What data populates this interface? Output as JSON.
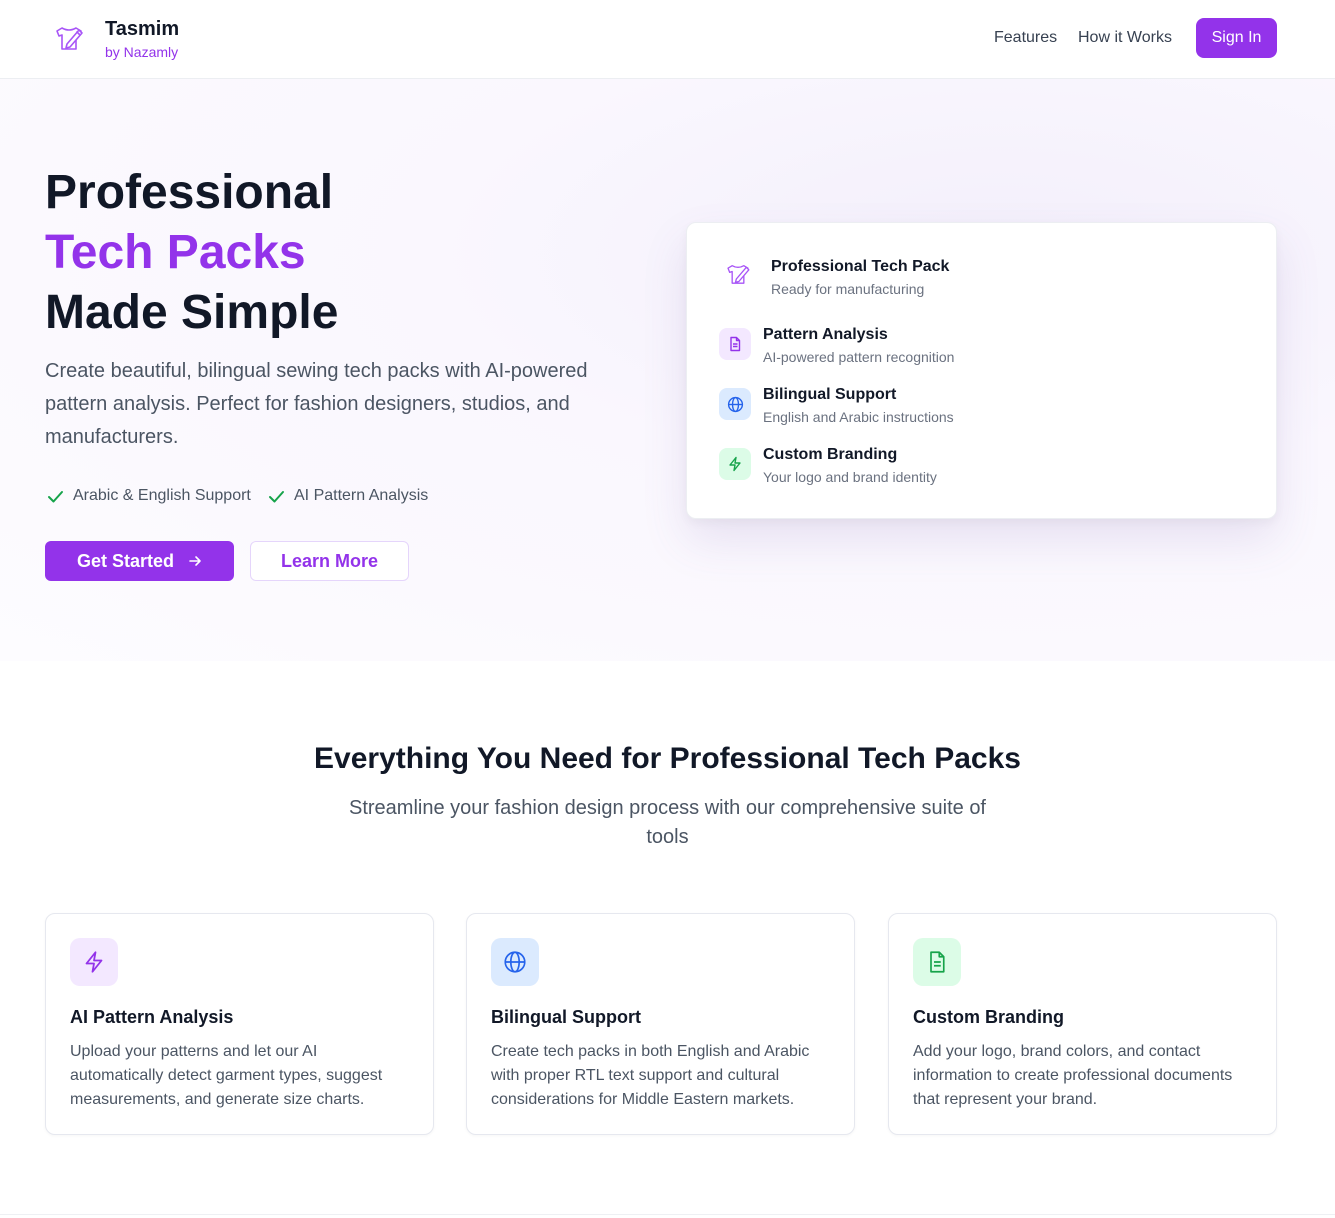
{
  "header": {
    "brand_name": "Tasmim",
    "brand_sub": "by Nazamly",
    "nav": [
      "Features",
      "How it Works"
    ],
    "signin_label": "Sign In"
  },
  "hero": {
    "title_line1": "Professional",
    "title_line2": "Tech Packs",
    "title_line3": "Made Simple",
    "description": "Create beautiful, bilingual sewing tech packs with AI-powered pattern analysis. Perfect for fashion designers, studios, and manufacturers.",
    "checks": [
      "Arabic & English Support",
      "AI Pattern Analysis"
    ],
    "primary_label": "Get Started",
    "secondary_label": "Learn More",
    "card": {
      "title": "Professional Tech Pack",
      "subtitle": "Ready for manufacturing",
      "items": [
        {
          "title": "Pattern Analysis",
          "sub": "AI-powered pattern recognition"
        },
        {
          "title": "Bilingual Support",
          "sub": "English and Arabic instructions"
        },
        {
          "title": "Custom Branding",
          "sub": "Your logo and brand identity"
        }
      ]
    }
  },
  "features": {
    "title": "Everything You Need for Professional Tech Packs",
    "subtitle": "Streamline your fashion design process with our comprehensive suite of tools",
    "cards": [
      {
        "title": "AI Pattern Analysis",
        "desc": "Upload your patterns and let our AI automatically detect garment types, suggest measurements, and generate size charts.",
        "icon": "lightning-icon"
      },
      {
        "title": "Bilingual Support",
        "desc": "Create tech packs in both English and Arabic with proper RTL text support and cultural considerations for Middle Eastern markets.",
        "icon": "globe-icon"
      },
      {
        "title": "Custom Branding",
        "desc": "Add your logo, brand colors, and contact information to create professional documents that represent your brand.",
        "icon": "document-icon"
      }
    ]
  },
  "colors": {
    "accent": "#9333ea",
    "text": "#111827",
    "muted": "#4b5563",
    "green": "#16a34a",
    "blue": "#2563eb"
  }
}
